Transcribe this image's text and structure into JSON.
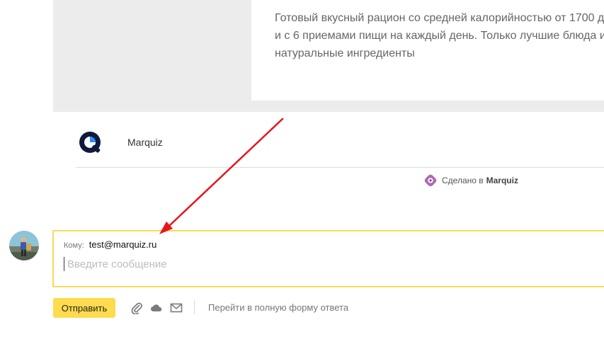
{
  "card": {
    "lines": [
      "Готовый вкусный рацион со средней калорийностью от 1700 д",
      "и с 6 приемами пищи на каждый день. Только лучшие блюда и",
      "натуральные ингредиенты"
    ]
  },
  "brand": {
    "name": "Marquiz",
    "made_in_prefix": "Сделано в",
    "made_in_brand": "Marquiz"
  },
  "compose": {
    "to_label": "Кому:",
    "to_value": "test@marquiz.ru",
    "message_placeholder": "Введите сообщение"
  },
  "actions": {
    "send_label": "Отправить",
    "full_form_label": "Перейти в полную форму ответа"
  },
  "colors": {
    "accent_yellow": "#ffdb4d",
    "compose_border": "#f5dc5a",
    "arrow_red": "#e8141b",
    "brand_navy": "#0f1a3c",
    "brand_blue": "#2a8cff"
  },
  "icons": {
    "attach": "paperclip-icon",
    "cloud": "cloud-icon",
    "template": "envelope-icon"
  }
}
